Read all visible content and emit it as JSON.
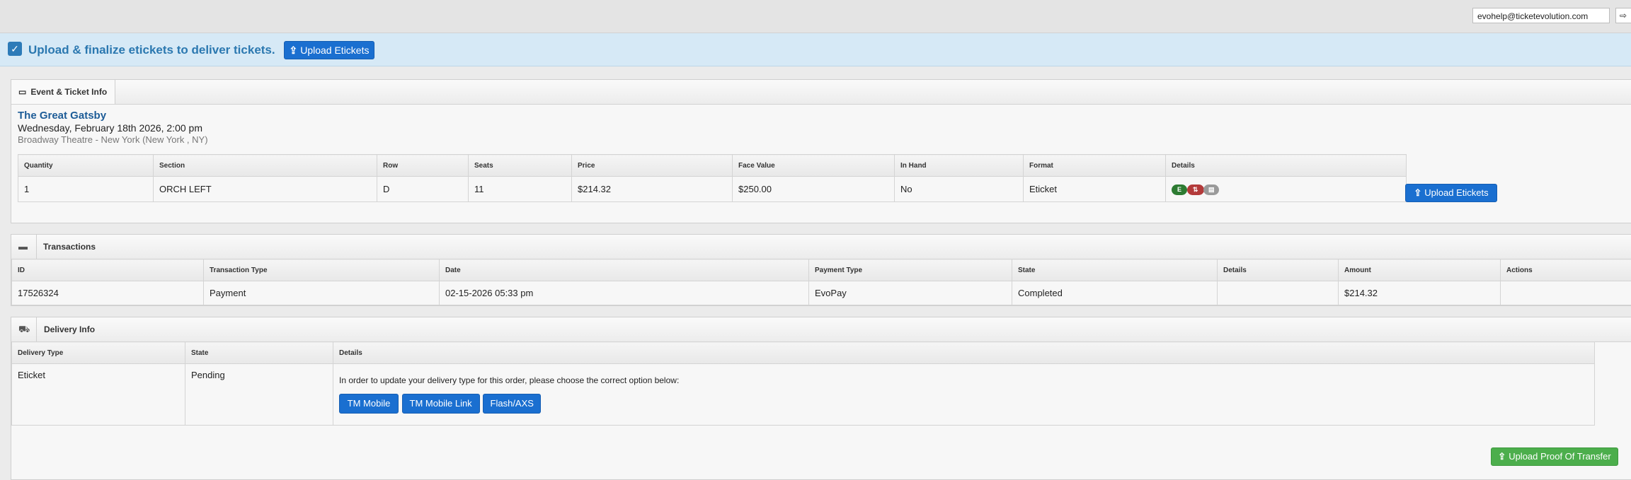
{
  "topbar": {
    "email": "evohelp@ticketevolution.com",
    "edge_button": "⇨"
  },
  "notice": {
    "message": "Upload & finalize etickets to deliver tickets.",
    "button_label": "Upload Etickets"
  },
  "event_panel": {
    "tab_label": "Event & Ticket Info",
    "title": "The Great Gatsby",
    "date": "Wednesday, February 18th 2026, 2:00 pm",
    "venue": "Broadway Theatre - New York (New York , NY)",
    "columns": [
      "Quantity",
      "Section",
      "Row",
      "Seats",
      "Price",
      "Face Value",
      "In Hand",
      "Format",
      "Details"
    ],
    "row": {
      "quantity": "1",
      "section": "ORCH LEFT",
      "row": "D",
      "seats": "11",
      "price": "$214.32",
      "face_value": "$250.00",
      "in_hand": "No",
      "format": "Eticket"
    },
    "detail_badges": [
      "E",
      "⇅",
      "▤"
    ],
    "upload_button": "Upload Etickets"
  },
  "transactions_panel": {
    "title": "Transactions",
    "columns": [
      "ID",
      "Transaction Type",
      "Date",
      "Payment Type",
      "State",
      "Details",
      "Amount",
      "Actions"
    ],
    "row": {
      "id": "17526324",
      "type": "Payment",
      "date": "02-15-2026 05:33 pm",
      "payment_type": "EvoPay",
      "state": "Completed",
      "details": "",
      "amount": "$214.32",
      "actions": ""
    }
  },
  "delivery_panel": {
    "title": "Delivery Info",
    "columns": [
      "Delivery Type",
      "State",
      "Details"
    ],
    "row": {
      "type": "Eticket",
      "state": "Pending",
      "details_text": "In order to update your delivery type for this order, please choose the correct option below:"
    },
    "option_buttons": [
      "TM Mobile",
      "TM Mobile Link",
      "Flash/AXS"
    ],
    "proof_button": "Upload Proof Of Transfer"
  },
  "colors": {
    "primary_button": "#1a6fd0",
    "success_button": "#4cae4c",
    "banner": "#d6e9f6",
    "link_title": "#1d5c97"
  }
}
